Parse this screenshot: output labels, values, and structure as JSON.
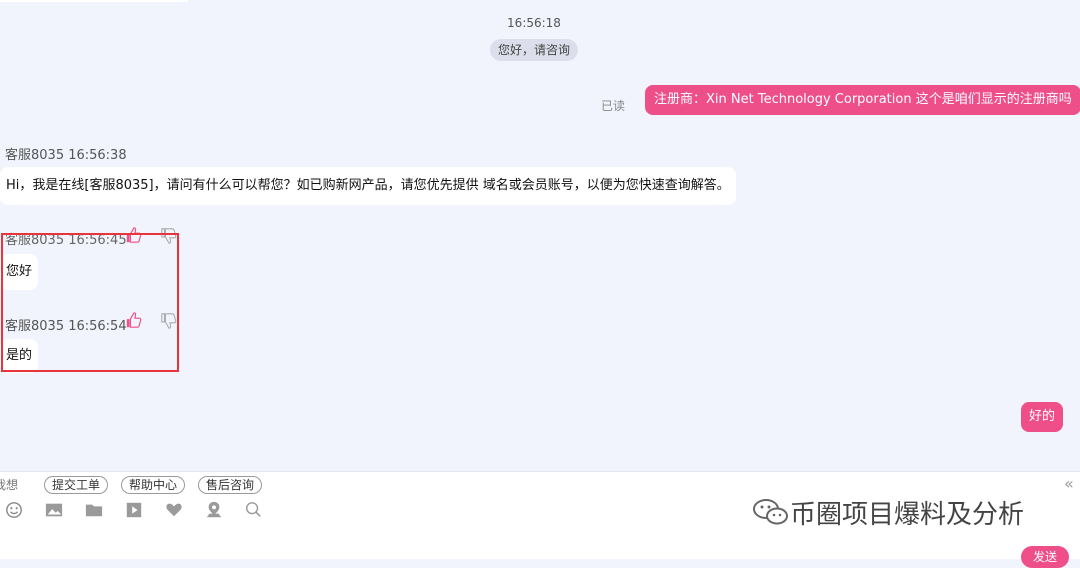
{
  "chat": {
    "center_time": "16:56:18",
    "system_greeting": "您好，请咨询",
    "read_status": "已读",
    "user_message_1": "注册商：Xin Net Technology Corporation  这个是咱们显示的注册商吗",
    "agent_meta_1": "客服8035 16:56:38",
    "agent_message_1": "Hi，我是在线[客服8035]，请问有什么可以帮您？如已购新网产品，请您优先提供 域名或会员账号，以便为您快速查询解答。",
    "agent_meta_2": "客服8035 16:56:45",
    "agent_message_2": "您好",
    "agent_meta_3": "客服8035 16:56:54",
    "agent_message_3": "是的",
    "user_message_2": "好的"
  },
  "toolbar": {
    "partial_label": "我想",
    "quick_buttons": [
      "提交工单",
      "帮助中心",
      "售后咨询"
    ],
    "collapse_icon": "double-chevron-left-icon",
    "tools": [
      "emoji-icon",
      "image-icon",
      "folder-icon",
      "video-icon",
      "heart-icon",
      "location-icon",
      "chat-search-icon"
    ],
    "send_label": "发送"
  },
  "watermark": "币圈项目爆料及分析",
  "colors": {
    "accent": "#ee4f89",
    "chat_bg": "#f1f4fc",
    "highlight_box": "#e8343a"
  }
}
